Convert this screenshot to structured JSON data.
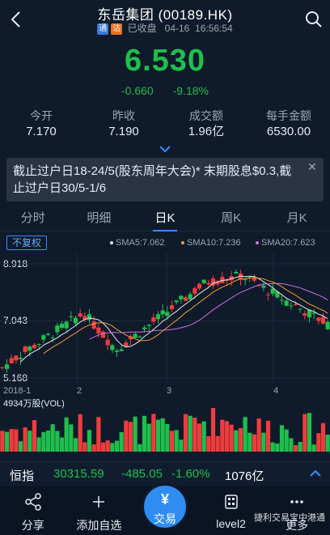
{
  "header": {
    "title": "东岳集团 (00189.HK)",
    "tag_tong": "通",
    "tag_gu": "沽",
    "status": "已收盘",
    "date": "04-16",
    "time": "16:56:54"
  },
  "quote": {
    "price": "6.530",
    "change": "-0.660",
    "change_pct": "-9.18%"
  },
  "stats": [
    {
      "label": "今开",
      "value": "7.170"
    },
    {
      "label": "昨收",
      "value": "7.190"
    },
    {
      "label": "成交额",
      "value": "1.96亿"
    },
    {
      "label": "每手金额",
      "value": "6530.00"
    }
  ],
  "notice": {
    "text": "截止过户日18-24/5(股东周年大会)* 末期股息$0.3,截止过户日30/5-1/6",
    "close": "✕"
  },
  "tabs": [
    "分时",
    "明细",
    "日K",
    "周K",
    "月K"
  ],
  "active_tab": "日K",
  "chart_options": {
    "adjust_label": "不复权",
    "ma": [
      {
        "label": "SMA5:7.062",
        "color": "#e8e8e8"
      },
      {
        "label": "SMA10:7.236",
        "color": "#f0a030"
      },
      {
        "label": "SMA20:7.623",
        "color": "#d070e0"
      }
    ]
  },
  "chart_data": {
    "type": "candlestick",
    "y_high_label": "8.918",
    "y_mid_label": "7.043",
    "y_low_label": "5.168",
    "ylim": [
      5.168,
      8.918
    ],
    "x_ticks": [
      "2018-1",
      "2",
      "3",
      "4"
    ],
    "volume_label": "4934万股(VOL)",
    "up_color": "#f03c3c",
    "down_color": "#1fbf4d"
  },
  "index_bar": {
    "name": "恒指",
    "value": "30315.59",
    "change": "-485.05",
    "change_pct": "-1.60%",
    "turnover": "1076亿"
  },
  "bottom_nav": [
    {
      "label": "分享",
      "icon": "share-icon"
    },
    {
      "label": "添加自选",
      "icon": "plus-icon"
    },
    {
      "label": "交易",
      "icon": "yen-icon"
    },
    {
      "label": "level2",
      "icon": "level2-icon"
    },
    {
      "label": "更多",
      "icon": "more-icon"
    }
  ],
  "watermark": "捷利交易宝中港通"
}
